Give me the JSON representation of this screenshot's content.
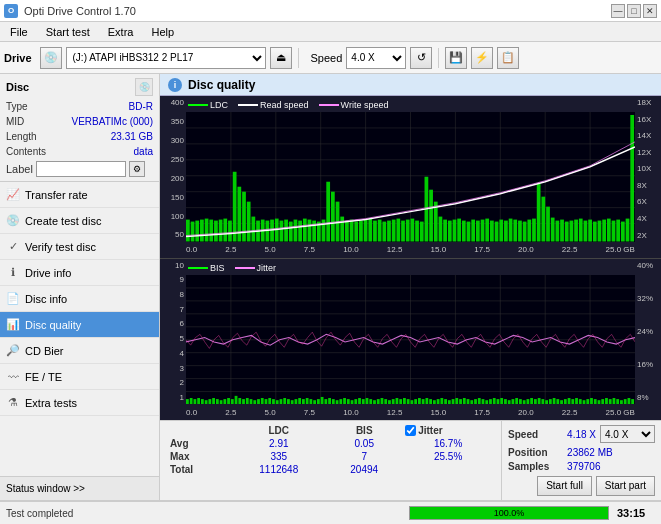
{
  "app": {
    "title": "Opti Drive Control 1.70",
    "icon": "O"
  },
  "titlebar": {
    "minimize": "—",
    "maximize": "□",
    "close": "✕"
  },
  "menu": {
    "items": [
      "File",
      "Start test",
      "Extra",
      "Help"
    ]
  },
  "toolbar": {
    "drive_label": "Drive",
    "drive_value": "(J:) ATAPI iHBS312  2 PL17",
    "speed_label": "Speed",
    "speed_value": "4.0 X"
  },
  "disc": {
    "label": "Disc",
    "type_key": "Type",
    "type_val": "BD-R",
    "mid_key": "MID",
    "mid_val": "VERBATIMc (000)",
    "length_key": "Length",
    "length_val": "23.31 GB",
    "contents_key": "Contents",
    "contents_val": "data",
    "label_key": "Label",
    "label_val": ""
  },
  "nav": {
    "items": [
      {
        "id": "transfer-rate",
        "label": "Transfer rate",
        "active": false
      },
      {
        "id": "create-test-disc",
        "label": "Create test disc",
        "active": false
      },
      {
        "id": "verify-test-disc",
        "label": "Verify test disc",
        "active": false
      },
      {
        "id": "drive-info",
        "label": "Drive info",
        "active": false
      },
      {
        "id": "disc-info",
        "label": "Disc info",
        "active": false
      },
      {
        "id": "disc-quality",
        "label": "Disc quality",
        "active": true
      },
      {
        "id": "cd-bier",
        "label": "CD Bier",
        "active": false
      },
      {
        "id": "fe-te",
        "label": "FE / TE",
        "active": false
      },
      {
        "id": "extra-tests",
        "label": "Extra tests",
        "active": false
      }
    ]
  },
  "disc_quality": {
    "title": "Disc quality",
    "legend_upper": [
      {
        "label": "LDC",
        "color": "#00ff00"
      },
      {
        "label": "Read speed",
        "color": "#ffffff"
      },
      {
        "label": "Write speed",
        "color": "#ff88ff"
      }
    ],
    "legend_lower": [
      {
        "label": "BIS",
        "color": "#00ff00"
      },
      {
        "label": "Jitter",
        "color": "#ff88ff"
      }
    ],
    "y_axis_upper_left": [
      "400",
      "350",
      "300",
      "250",
      "200",
      "150",
      "100",
      "50"
    ],
    "y_axis_upper_right": [
      "18X",
      "16X",
      "14X",
      "12X",
      "10X",
      "8X",
      "6X",
      "4X",
      "2X"
    ],
    "y_axis_lower_left": [
      "10",
      "9",
      "8",
      "7",
      "6",
      "5",
      "4",
      "3",
      "2",
      "1"
    ],
    "y_axis_lower_right": [
      "40%",
      "32%",
      "24%",
      "16%",
      "8%"
    ],
    "x_axis": [
      "0.0",
      "2.5",
      "5.0",
      "7.5",
      "10.0",
      "12.5",
      "15.0",
      "17.5",
      "20.0",
      "22.5",
      "25.0 GB"
    ]
  },
  "stats": {
    "ldc_label": "LDC",
    "bis_label": "BIS",
    "jitter_label": "Jitter",
    "jitter_checked": true,
    "speed_label": "Speed",
    "speed_val": "4.18 X",
    "speed_select": "4.0 X",
    "avg_label": "Avg",
    "avg_ldc": "2.91",
    "avg_bis": "0.05",
    "avg_jitter": "16.7%",
    "max_label": "Max",
    "max_ldc": "335",
    "max_bis": "7",
    "max_jitter": "25.5%",
    "total_label": "Total",
    "total_ldc": "1112648",
    "total_bis": "20494",
    "position_label": "Position",
    "position_val": "23862 MB",
    "samples_label": "Samples",
    "samples_val": "379706",
    "start_full": "Start full",
    "start_part": "Start part"
  },
  "statusbar": {
    "text": "Test completed",
    "progress": 100,
    "progress_text": "100.0%",
    "time": "33:15"
  },
  "status_window": {
    "label": "Status window >>",
    "arrow": "»"
  }
}
